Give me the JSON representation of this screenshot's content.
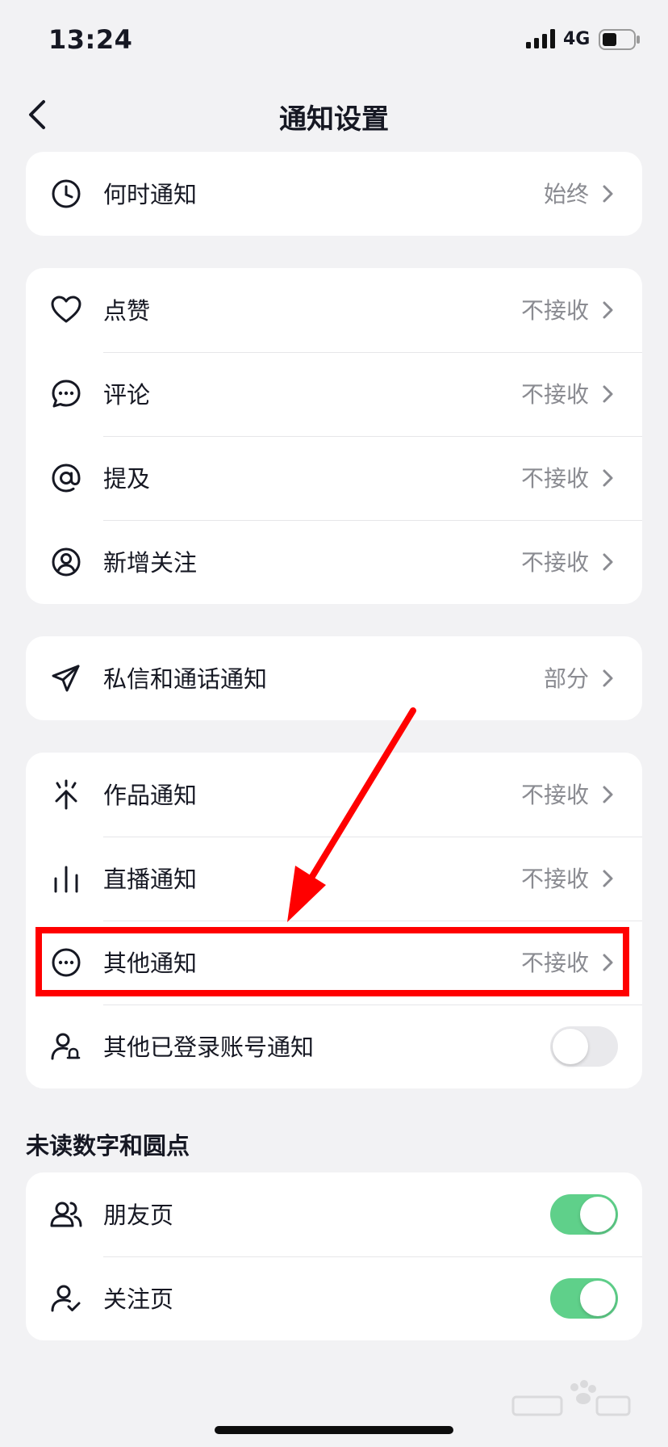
{
  "status_bar": {
    "time": "13:24",
    "network": "4G"
  },
  "nav": {
    "title": "通知设置"
  },
  "group1": [
    {
      "label": "何时通知",
      "value": "始终",
      "icon": "clock-icon"
    }
  ],
  "group2": [
    {
      "label": "点赞",
      "value": "不接收",
      "icon": "heart-icon"
    },
    {
      "label": "评论",
      "value": "不接收",
      "icon": "comment-icon"
    },
    {
      "label": "提及",
      "value": "不接收",
      "icon": "at-icon"
    },
    {
      "label": "新增关注",
      "value": "不接收",
      "icon": "user-circle-icon"
    }
  ],
  "group3": [
    {
      "label": "私信和通话通知",
      "value": "部分",
      "icon": "send-icon"
    }
  ],
  "group4": [
    {
      "label": "作品通知",
      "value": "不接收",
      "icon": "sparkle-icon"
    },
    {
      "label": "直播通知",
      "value": "不接收",
      "icon": "bars-icon"
    },
    {
      "label": "其他通知",
      "value": "不接收",
      "icon": "more-circle-icon"
    },
    {
      "label": "其他已登录账号通知",
      "toggle": false,
      "icon": "user-bell-icon"
    }
  ],
  "section_title": "未读数字和圆点",
  "group5": [
    {
      "label": "朋友页",
      "toggle": true,
      "icon": "users-icon"
    },
    {
      "label": "关注页",
      "toggle": true,
      "icon": "user-check-icon"
    }
  ],
  "colors": {
    "toggle_on": "#5fd08a",
    "highlight": "#ff0000",
    "background": "#f2f2f4"
  }
}
